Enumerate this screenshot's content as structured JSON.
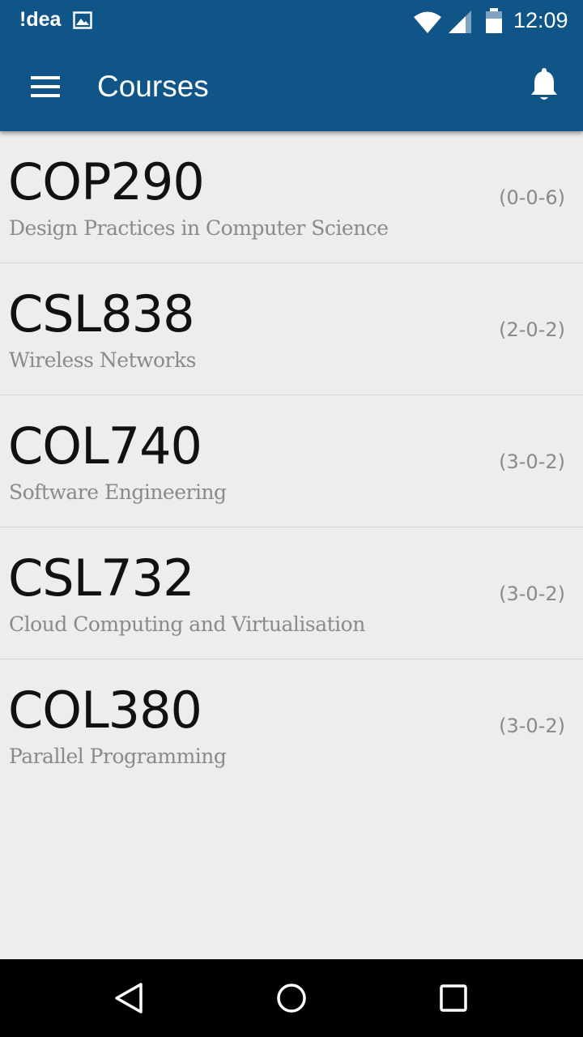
{
  "status_bar": {
    "carrier": "!dea",
    "time": "12:09",
    "icons": [
      "image-notification-icon",
      "wifi-icon",
      "signal-icon",
      "battery-icon"
    ]
  },
  "app_bar": {
    "title": "Courses",
    "menu_icon": "hamburger-menu-icon",
    "notification_icon": "bell-icon",
    "color": "#105588"
  },
  "courses": [
    {
      "code": "COP290",
      "name": "Design Practices in Computer Science",
      "credits": "(0-0-6)"
    },
    {
      "code": "CSL838",
      "name": "Wireless Networks",
      "credits": "(2-0-2)"
    },
    {
      "code": "COL740",
      "name": "Software Engineering",
      "credits": "(3-0-2)"
    },
    {
      "code": "CSL732",
      "name": "Cloud Computing and Virtualisation",
      "credits": "(3-0-2)"
    },
    {
      "code": "COL380",
      "name": "Parallel Programming",
      "credits": "(3-0-2)"
    }
  ],
  "nav_bar": {
    "icons": [
      "back-icon",
      "home-icon",
      "recents-icon"
    ]
  }
}
